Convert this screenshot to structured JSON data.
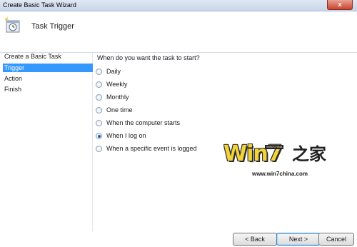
{
  "window": {
    "title": "Create Basic Task Wizard",
    "close_label": "x"
  },
  "header": {
    "icon": "task-clock-icon",
    "title": "Task Trigger"
  },
  "sidebar": {
    "items": [
      {
        "label": "Create a Basic Task",
        "active": false
      },
      {
        "label": "Trigger",
        "active": true
      },
      {
        "label": "Action",
        "active": false
      },
      {
        "label": "Finish",
        "active": false
      }
    ]
  },
  "main": {
    "question": "When do you want the task to start?",
    "options": [
      {
        "label": "Daily",
        "selected": false
      },
      {
        "label": "Weekly",
        "selected": false
      },
      {
        "label": "Monthly",
        "selected": false
      },
      {
        "label": "One time",
        "selected": false
      },
      {
        "label": "When the computer starts",
        "selected": false
      },
      {
        "label": "When I log on",
        "selected": true
      },
      {
        "label": "When a specific event is logged",
        "selected": false
      }
    ]
  },
  "watermark": {
    "brand": "Win7",
    "tag": "WIN7CHINA",
    "cn": "之家",
    "url": "www.win7china.com"
  },
  "footer": {
    "back_label": "< Back",
    "next_label": "Next >",
    "cancel_label": "Cancel"
  },
  "colors": {
    "selection": "#3399ff",
    "title_bar": "#dfe8f3",
    "close_button": "#c9442f"
  }
}
